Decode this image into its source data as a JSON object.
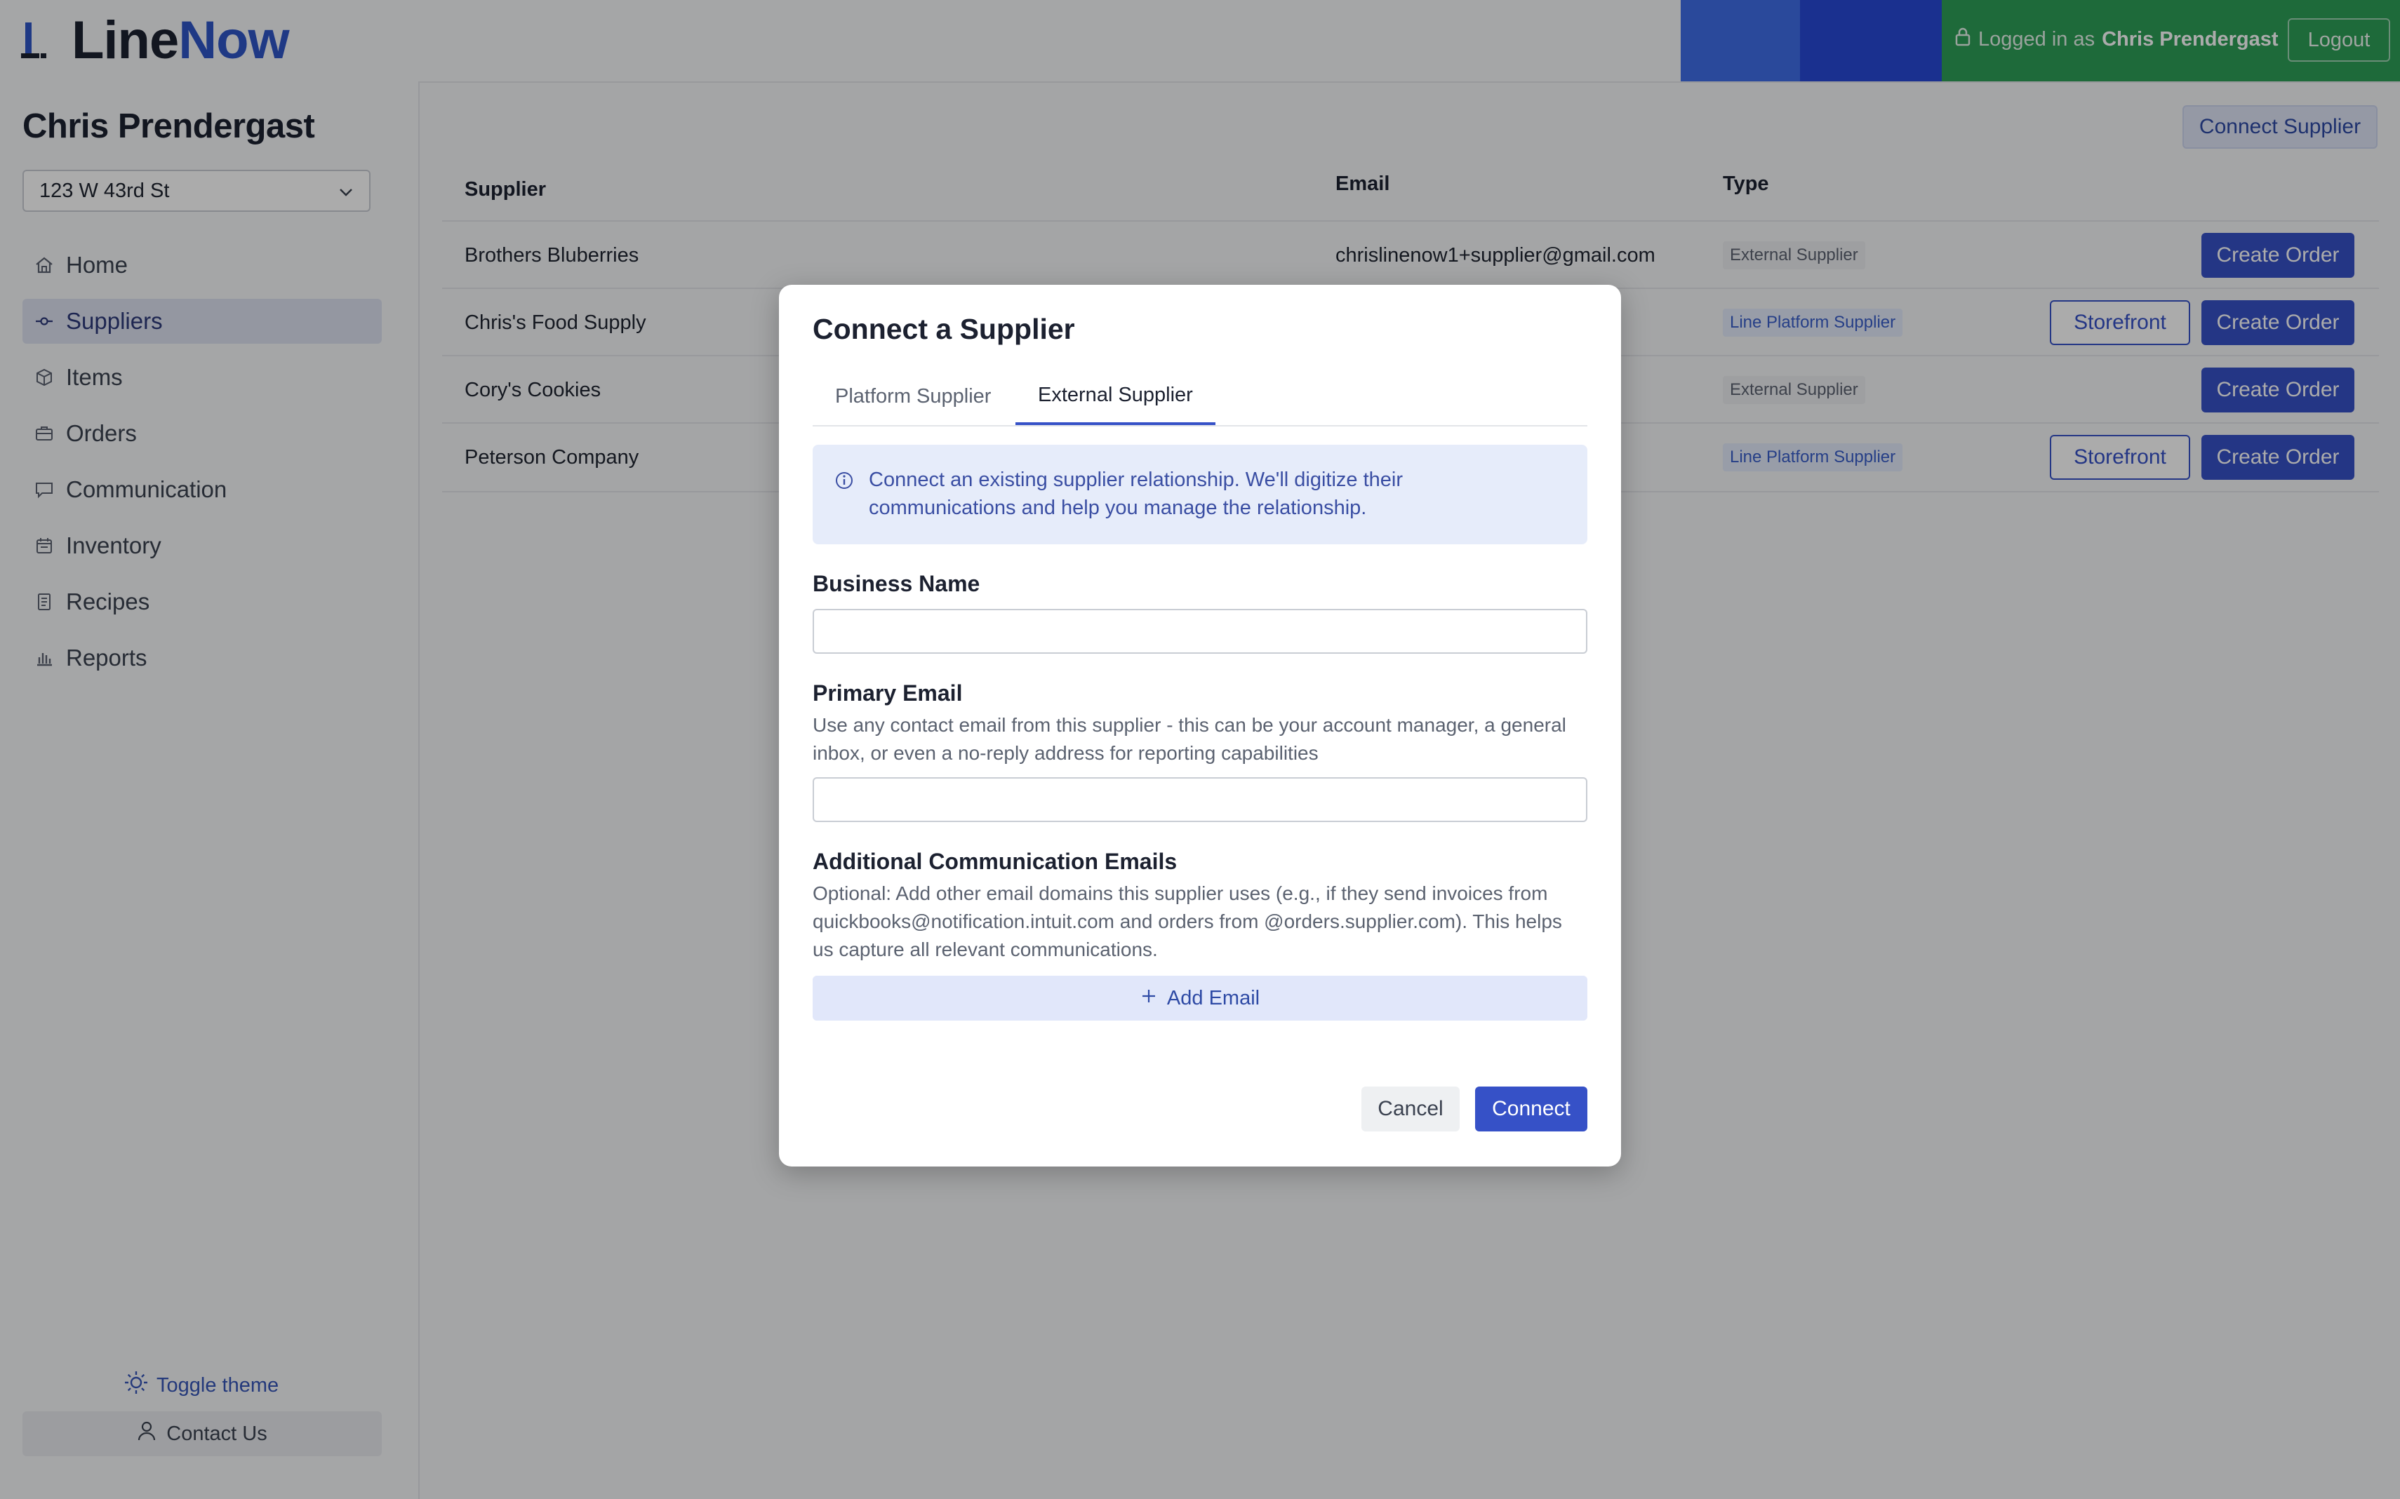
{
  "header": {
    "logo_part1": "Line",
    "logo_part2": "Now",
    "logged_in_prefix": "Logged in as",
    "logged_in_user": "Chris Prendergast",
    "logout_label": "Logout",
    "colors": {
      "stripe_light_blue": "#3f6ee8",
      "stripe_blue": "#2748d6",
      "stripe_green": "#2e9e57"
    }
  },
  "sidebar": {
    "user_name": "Chris Prendergast",
    "location": "123 W 43rd St",
    "items": [
      {
        "label": "Home",
        "icon": "home-icon"
      },
      {
        "label": "Suppliers",
        "icon": "supplier-icon",
        "active": true
      },
      {
        "label": "Items",
        "icon": "box-icon"
      },
      {
        "label": "Orders",
        "icon": "briefcase-icon"
      },
      {
        "label": "Communication",
        "icon": "chat-icon"
      },
      {
        "label": "Inventory",
        "icon": "calendar-icon"
      },
      {
        "label": "Recipes",
        "icon": "document-icon"
      },
      {
        "label": "Reports",
        "icon": "bar-chart-icon"
      }
    ],
    "toggle_theme": "Toggle theme",
    "contact_us": "Contact Us"
  },
  "main": {
    "connect_supplier": "Connect Supplier",
    "columns": {
      "supplier": "Supplier",
      "email": "Email",
      "type": "Type"
    },
    "rows": [
      {
        "supplier": "Brothers Bluberries",
        "email": "chrislinenow1+supplier@gmail.com",
        "type": "External Supplier",
        "storefront": "",
        "create_order": "Create Order"
      },
      {
        "supplier": "Chris's Food Supply",
        "email": "",
        "type": "Line Platform Supplier",
        "storefront": "Storefront",
        "create_order": "Create Order"
      },
      {
        "supplier": "Cory's Cookies",
        "email": "",
        "type": "External Supplier",
        "storefront": "",
        "create_order": "Create Order"
      },
      {
        "supplier": "Peterson Company",
        "email": "",
        "type": "Line Platform Supplier",
        "storefront": "Storefront",
        "create_order": "Create Order"
      }
    ]
  },
  "modal": {
    "title": "Connect a Supplier",
    "tabs": [
      "Platform Supplier",
      "External Supplier"
    ],
    "active_tab": "External Supplier",
    "info": "Connect an existing supplier relationship. We'll digitize their communications and help you manage the relationship.",
    "business_name_label": "Business Name",
    "business_name_value": "",
    "primary_email_label": "Primary Email",
    "primary_email_help": "Use any contact email from this supplier - this can be your account manager, a general inbox, or even a no-reply address for reporting capabilities",
    "primary_email_value": "",
    "additional_label": "Additional Communication Emails",
    "additional_help": "Optional: Add other email domains this supplier uses (e.g., if they send invoices from quickbooks@notification.intuit.com and orders from @orders.supplier.com). This helps us capture all relevant communications.",
    "add_email": "Add Email",
    "cancel": "Cancel",
    "connect": "Connect"
  }
}
